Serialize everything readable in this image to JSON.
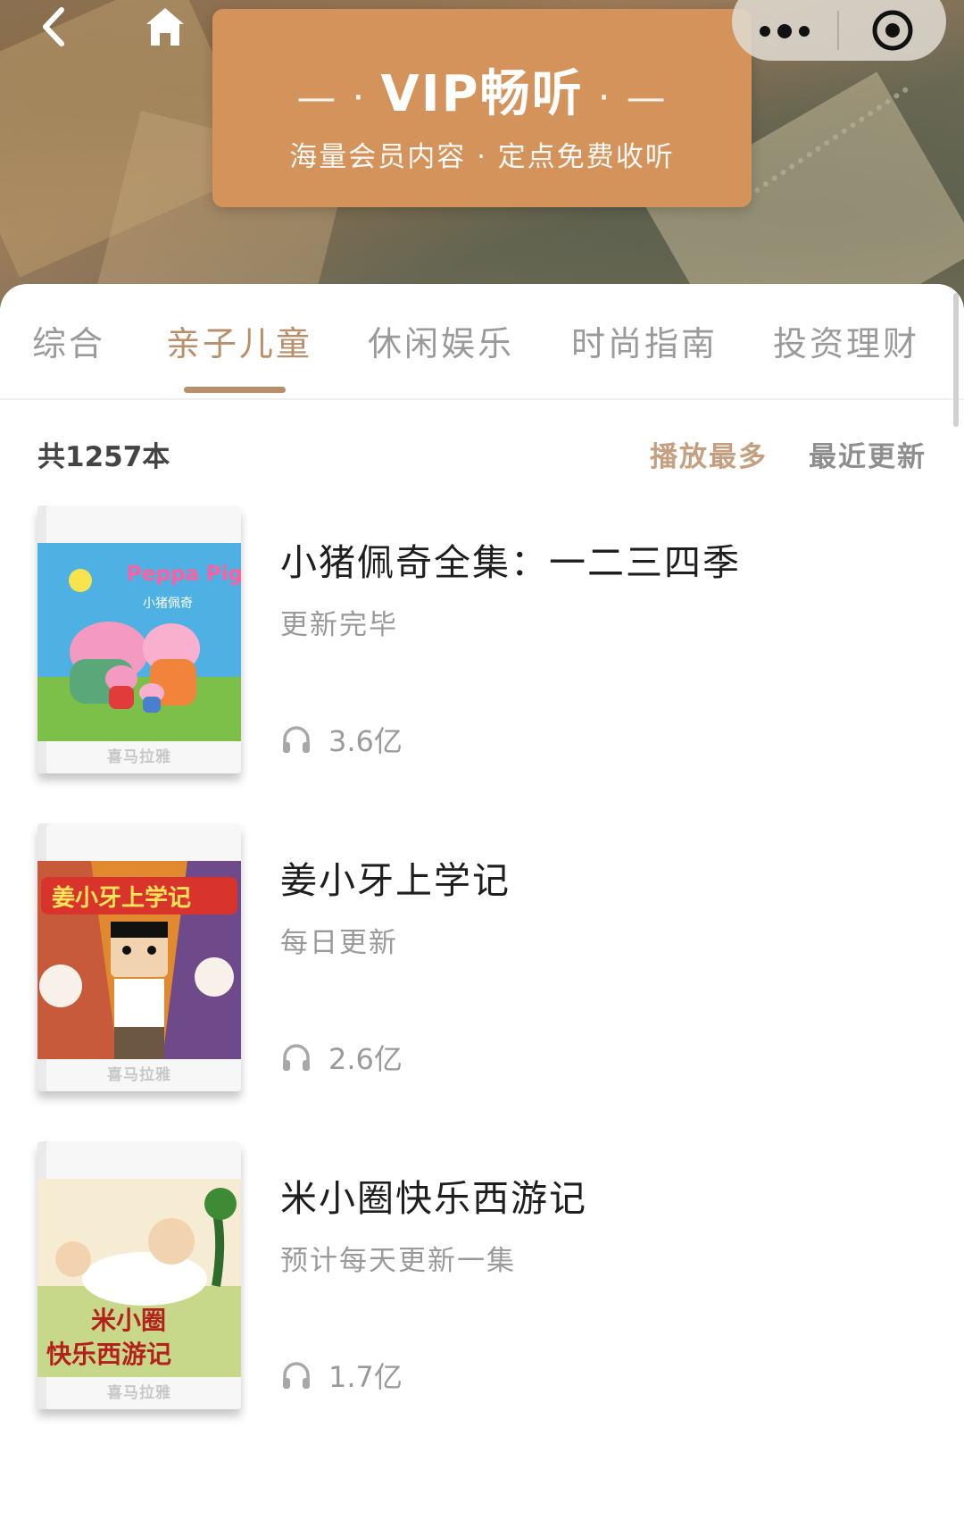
{
  "nav": {
    "back_icon": "chevron-left-icon",
    "home_icon": "home-icon",
    "more_icon": "more-dots-icon",
    "target_icon": "target-icon"
  },
  "banner": {
    "title": "VIP畅听",
    "subtitle": "海量会员内容 · 定点免费收听",
    "color": "#d3935a"
  },
  "tabs": [
    {
      "label": "综合",
      "active": false
    },
    {
      "label": "亲子儿童",
      "active": true
    },
    {
      "label": "休闲娱乐",
      "active": false
    },
    {
      "label": "时尚指南",
      "active": false
    },
    {
      "label": "投资理财",
      "active": false
    }
  ],
  "list_header": {
    "count": "共1257本",
    "sort_options": [
      "播放最多",
      "最近更新"
    ],
    "active_sort": "播放最多"
  },
  "books": [
    {
      "title": "小猪佩奇全集：一二三四季",
      "status": "更新完毕",
      "plays": "3.6亿",
      "cover_text": "Peppa Pig",
      "cover_sub": "小猪佩奇",
      "cover_logo": "喜马拉雅"
    },
    {
      "title": "姜小牙上学记",
      "status": "每日更新",
      "plays": "2.6亿",
      "cover_text": "姜小牙上学记",
      "cover_logo": "喜马拉雅"
    },
    {
      "title": "米小圈快乐西游记",
      "status": "预计每天更新一集",
      "plays": "1.7亿",
      "cover_text": "米小圈",
      "cover_sub": "快乐西游记",
      "cover_logo": "喜马拉雅"
    }
  ],
  "colors": {
    "accent": "#b98f6b",
    "banner": "#d3935a",
    "text_primary": "#1e1e1e",
    "text_secondary": "#9a9a9a"
  }
}
